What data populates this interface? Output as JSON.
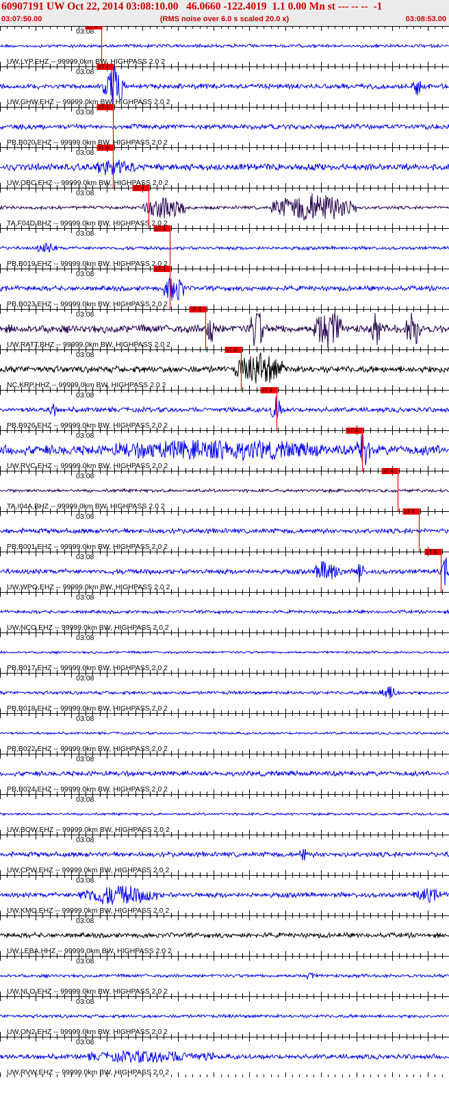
{
  "header": {
    "title": "60907191 UW Oct 22, 2014 03:08:10.00   46.0660 -122.4019  1.1 0.00 Mn st --- -- --  -1",
    "start_time": "03:07:50.00",
    "note": "(RMS noise over 6.0 s scaled 20.0 x)",
    "end_time": "03:08:53.00"
  },
  "chart_data": {
    "type": "line",
    "title": "60907191 UW Oct 22, 2014 03:08:10.00   46.0660 -122.4019  1.1 0.00 Mn st --- -- --  -1",
    "x_range": [
      "03:07:50.00",
      "03:08:53.00"
    ],
    "x_tick_label": "03:08",
    "pick_label": "xT 4",
    "colors": {
      "header": "#cc0000",
      "pick": "#ee0000",
      "blue": "#0000ee",
      "black": "#000000",
      "purple": "#22004a"
    },
    "traces": [
      {
        "name": "UW,LYP,EHZ -- 99999.0km BW, HIGHPASS  2.0  2",
        "color": "blue",
        "pick_s": 14.2,
        "amp": 2,
        "events": [
          [
            0,
            63,
            0,
            8,
            "spike"
          ]
        ]
      },
      {
        "name": "UW,GHW,EHZ -- 99999.0km BW, HIGHPASS  2.0  2",
        "color": "blue",
        "pick_s": 15.8,
        "amp": 3,
        "events": [
          [
            14.5,
            17.5,
            30,
            1.2,
            "burst"
          ],
          [
            58,
            59,
            12,
            0.5,
            "burst"
          ]
        ]
      },
      {
        "name": "PB,B020,EHZ -- 99999.0km BW, HIGHPASS  2.0  2",
        "color": "blue",
        "pick_s": 15.8,
        "amp": 3,
        "events": []
      },
      {
        "name": "UW,OBC,EHZ -- 99999.0km BW, HIGHPASS  2.0  2",
        "color": "blue",
        "pick_s": 15.8,
        "amp": 4,
        "events": [
          [
            13,
            19,
            8,
            4,
            "burst"
          ]
        ]
      },
      {
        "name": "TA,F04D,BHZ -- 99999.0km BW, HIGHPASS  2.0  2",
        "color": "purple",
        "pick_s": 20.8,
        "amp": 2,
        "events": [
          [
            20,
            26,
            16,
            4,
            "burst"
          ],
          [
            38,
            50,
            20,
            10,
            "burst"
          ]
        ]
      },
      {
        "name": "PB,B019,EHZ -- 99999.0km BW, HIGHPASS  2.0  2",
        "color": "blue",
        "pick_s": 23.8,
        "amp": 2,
        "events": [
          [
            5,
            8,
            6,
            2,
            "burst"
          ]
        ]
      },
      {
        "name": "PB,B023,EHZ -- 99999.0km BW, HIGHPASS  2.0  2",
        "color": "blue",
        "pick_s": 23.8,
        "amp": 3,
        "events": [
          [
            23,
            26,
            18,
            2,
            "burst"
          ]
        ]
      },
      {
        "name": "UW,RATT,BHZ -- 99999.0km BW, HIGHPASS  2.0  2",
        "color": "purple",
        "pick_s": 28.8,
        "amp": 5,
        "events": [
          [
            29,
            30,
            22,
            1,
            "burst"
          ],
          [
            35,
            37,
            28,
            1.5,
            "burst"
          ],
          [
            44,
            48,
            26,
            2,
            "burst"
          ],
          [
            52,
            53.5,
            20,
            1.2,
            "burst"
          ],
          [
            57,
            59,
            22,
            1.2,
            "burst"
          ]
        ]
      },
      {
        "name": "NC,KRP,HHZ -- 99999.0km BW, HIGHPASS  2.0  2",
        "color": "black",
        "pick_s": 33.8,
        "amp": 4,
        "events": [
          [
            33,
            40,
            20,
            2.5,
            "burst"
          ]
        ]
      },
      {
        "name": "PB,B926,EHZ -- 99999.0km BW, HIGHPASS  2.0  2",
        "color": "blue",
        "pick_s": 38.8,
        "amp": 3,
        "events": [
          [
            38,
            39.5,
            18,
            1,
            "burst"
          ],
          [
            7,
            8,
            10,
            0.8,
            "burst"
          ]
        ]
      },
      {
        "name": "UW,RVC,EHZ -- 99999.0km BW, HIGHPASS  2.0  2",
        "color": "blue",
        "pick_s": 50.8,
        "amp": 6,
        "events": [
          [
            16,
            45,
            9,
            15,
            "burst"
          ],
          [
            50,
            52,
            22,
            1.5,
            "burst"
          ]
        ]
      },
      {
        "name": "TA,I04A,BHZ -- 99999.0km BW, HIGHPASS  2.0  2",
        "color": "purple",
        "pick_s": 55.8,
        "amp": 2,
        "events": []
      },
      {
        "name": "PB,B001,EHZ -- 99999.0km BW, HIGHPASS  2.0  2",
        "color": "blue",
        "pick_s": 58.8,
        "amp": 3,
        "events": []
      },
      {
        "name": "UW,WPO,EHZ -- 99999.0km BW, HIGHPASS  2.0  2",
        "color": "blue",
        "pick_s": 61.8,
        "amp": 3,
        "events": [
          [
            44,
            48,
            14,
            2,
            "burst"
          ],
          [
            50,
            51,
            20,
            0.8,
            "burst"
          ],
          [
            62,
            63,
            18,
            1,
            "burst"
          ]
        ]
      },
      {
        "name": "UW,NCO,EHZ -- 99999.0km BW, HIGHPASS  2.0  2",
        "color": "blue",
        "pick_s": 68,
        "amp": 2,
        "events": []
      },
      {
        "name": "PB,B017,EHZ -- 99999.0km BW, HIGHPASS  2.0  2",
        "color": "blue",
        "pick_s": 68,
        "amp": 1.5,
        "events": []
      },
      {
        "name": "PB,B018,EHZ -- 99999.0km BW, HIGHPASS  2.0  2",
        "color": "blue",
        "pick_s": 68,
        "amp": 2,
        "events": [
          [
            53,
            56,
            8,
            1.5,
            "burst"
          ]
        ]
      },
      {
        "name": "PB,B022,EHZ -- 99999.0km BW, HIGHPASS  2.0  2",
        "color": "blue",
        "pick_s": 68,
        "amp": 1.5,
        "events": []
      },
      {
        "name": "PB,B024,EHZ -- 99999.0km BW, HIGHPASS  2.0  2",
        "color": "blue",
        "pick_s": 68,
        "amp": 3,
        "events": []
      },
      {
        "name": "UW,BOW,EHZ -- 99999.0km BW, HIGHPASS  2.0  2",
        "color": "blue",
        "pick_s": 68,
        "amp": 1.5,
        "events": []
      },
      {
        "name": "UW,CPW,EHZ -- 99999.0km BW, HIGHPASS  2.0  2",
        "color": "blue",
        "pick_s": 68,
        "amp": 3,
        "events": [
          [
            42,
            43,
            10,
            0.5,
            "burst"
          ]
        ]
      },
      {
        "name": "UW,KMO,EHZ -- 99999.0km BW, HIGHPASS  2.0  2",
        "color": "blue",
        "pick_s": 68,
        "amp": 3,
        "events": [
          [
            11,
            22,
            12,
            6,
            "burst"
          ],
          [
            58,
            62,
            7,
            3,
            "burst"
          ]
        ]
      },
      {
        "name": "UW,LEBA,HHZ -- 99999.0km BW, HIGHPASS  2.0  2",
        "color": "black",
        "pick_s": 68,
        "amp": 3,
        "events": []
      },
      {
        "name": "UW,NLO,EHZ -- 99999.0km BW, HIGHPASS  2.0  2",
        "color": "blue",
        "pick_s": 68,
        "amp": 2,
        "events": [
          [
            43,
            44,
            6,
            0.5,
            "burst"
          ]
        ]
      },
      {
        "name": "UW,ON2,EHZ -- 99999.0km BW, HIGHPASS  2.0  2",
        "color": "blue",
        "pick_s": 68,
        "amp": 2,
        "events": []
      },
      {
        "name": "UW,RVW,EHZ -- 99999.0km BW, HIGHPASS  2.0  2",
        "color": "blue",
        "pick_s": 68,
        "amp": 3,
        "events": [
          [
            12,
            30,
            6,
            8,
            "burst"
          ]
        ]
      }
    ]
  }
}
